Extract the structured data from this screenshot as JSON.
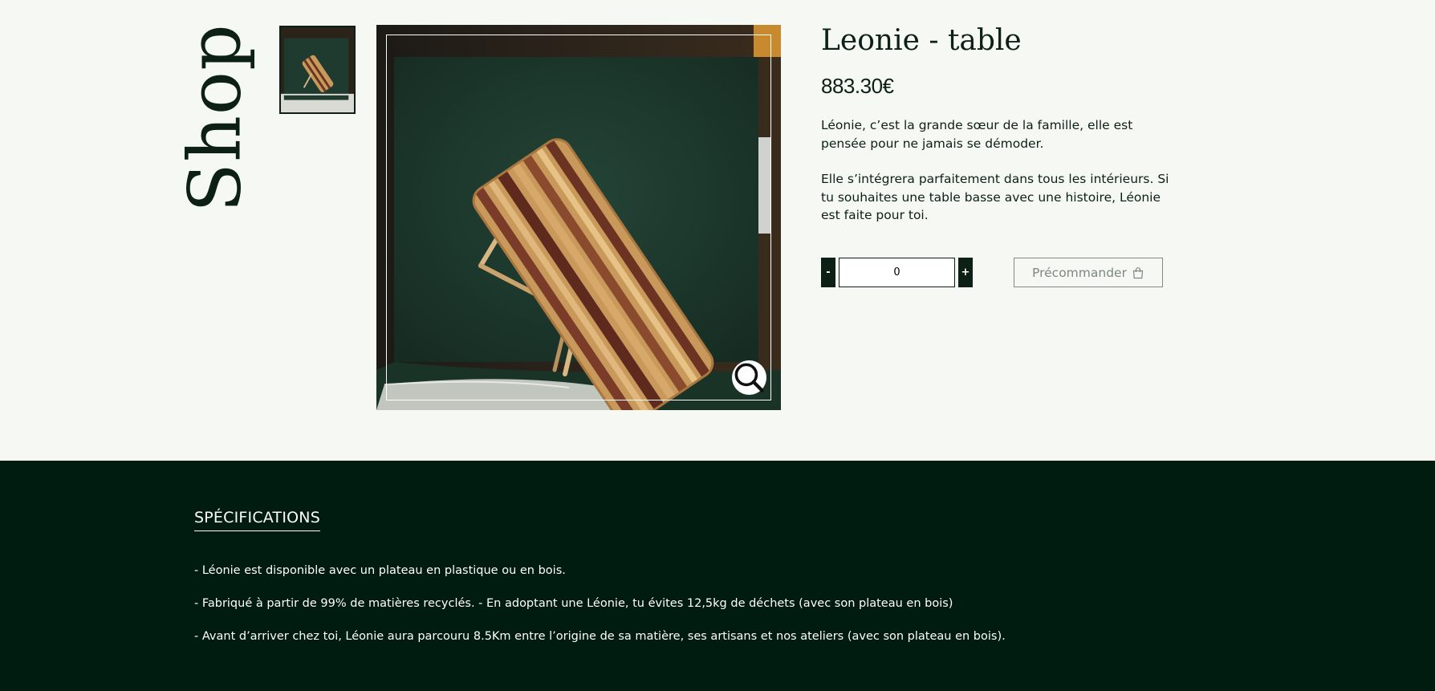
{
  "page": {
    "section_title": "Shop"
  },
  "product": {
    "title": "Leonie - table",
    "price": "883.30€",
    "description": [
      "Léonie, c’est la grande sœur de la famille, elle est pensée pour ne jamais se démoder.",
      "Elle s’intégrera parfaitement dans tous les intérieurs. Si tu souhaites une table basse avec une histoire, Léonie est faite pour toi."
    ],
    "quantity": {
      "minus_label": "-",
      "value": "0",
      "plus_label": "+"
    },
    "preorder_label": "Précommander",
    "preorder_icon": "shopping-bag-icon",
    "zoom_icon": "magnifier-icon"
  },
  "specifications": {
    "heading": "SPÉCIFICATIONS",
    "items": [
      "- Léonie est disponible avec un plateau en plastique ou en bois.",
      "- Fabriqué à partir de 99% de matières recyclés. - En adoptant une Léonie, tu évites 12,5kg de déchets (avec son plateau en bois)",
      "- Avant d’arriver chez toi, Léonie aura parcouru 8.5Km entre l’origine de sa matière, ses artisans et nos ateliers (avec son plateau en bois)."
    ]
  },
  "colors": {
    "brand_dark_green": "#0c2016",
    "footer_background": "#001b10",
    "page_background": "#f6f8f4"
  }
}
